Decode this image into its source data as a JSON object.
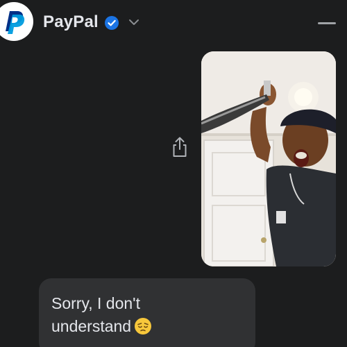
{
  "chat": {
    "title": "PayPal",
    "avatar_icon": "paypal-logo",
    "verified_icon": "verified-badge-icon",
    "chevron_icon": "chevron-down-icon",
    "minimize_icon": "minimize-icon"
  },
  "messages": {
    "outgoing_photo": {
      "type": "image",
      "description_icon": "photo-attachment",
      "share_icon": "share-icon"
    },
    "incoming_text": {
      "line1": "Sorry, I don't",
      "line2": "understand",
      "emoji_icon": "pensive-face-emoji"
    }
  },
  "colors": {
    "background": "#1c1d1e",
    "bubble": "#303133",
    "text": "#e4e6eb",
    "verified_blue": "#1b74e4",
    "paypal_dark_blue": "#003087",
    "paypal_light_blue": "#009cde"
  }
}
